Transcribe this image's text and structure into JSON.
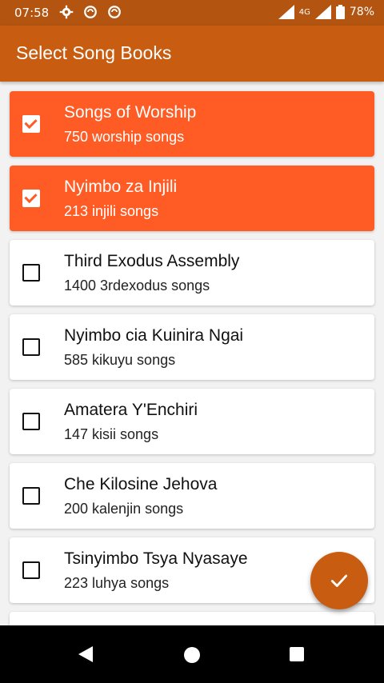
{
  "status_bar": {
    "time": "07:58",
    "battery": "78%",
    "network": "4G",
    "icons_left": [
      "gear-icon",
      "sync-icon",
      "sync-icon"
    ],
    "icons_right": [
      "signal-icon",
      "signal-icon",
      "battery-icon"
    ]
  },
  "app_bar": {
    "title": "Select Song Books"
  },
  "books": [
    {
      "title": "Songs of Worship",
      "subtitle": "750 worship songs",
      "selected": true
    },
    {
      "title": "Nyimbo za Injili",
      "subtitle": "213 injili songs",
      "selected": true
    },
    {
      "title": "Third Exodus Assembly",
      "subtitle": "1400 3rdexodus songs",
      "selected": false
    },
    {
      "title": "Nyimbo cia Kuinira Ngai",
      "subtitle": "585 kikuyu songs",
      "selected": false
    },
    {
      "title": "Amatera Y'Enchiri",
      "subtitle": "147 kisii songs",
      "selected": false
    },
    {
      "title": "Che Kilosine Jehova",
      "subtitle": "200 kalenjin songs",
      "selected": false
    },
    {
      "title": "Tsinyimbo Tsya Nyasaye",
      "subtitle": "223 luhya songs",
      "selected": false
    }
  ],
  "fab": {
    "icon": "check-icon"
  },
  "colors": {
    "accent": "#fe5c24",
    "app_bar": "#c85d12",
    "status_bar": "#b35510"
  }
}
